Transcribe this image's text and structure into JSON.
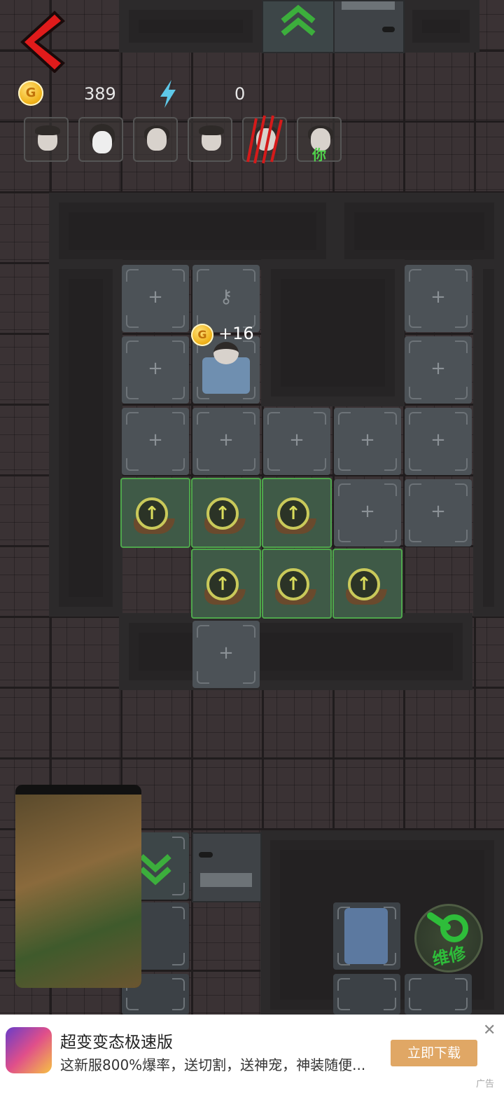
{
  "hud": {
    "coins": "389",
    "energy": "0"
  },
  "players": [
    {
      "name": "player-1"
    },
    {
      "name": "player-2"
    },
    {
      "name": "player-3"
    },
    {
      "name": "player-4"
    },
    {
      "name": "player-5-attacked"
    },
    {
      "name": "player-self",
      "tag": "你"
    }
  ],
  "reward": {
    "amount": "+16"
  },
  "repair_button": {
    "label": "维修"
  },
  "ad": {
    "title": "超变变态极速版",
    "description": "这新服800%爆率，送切割，送神宠，神装随便...",
    "cta": "立即下载",
    "tag": "广告"
  },
  "colors": {
    "accent_green": "#4ea64c",
    "back_red": "#e01b1b",
    "ad_button": "#e0a765"
  }
}
